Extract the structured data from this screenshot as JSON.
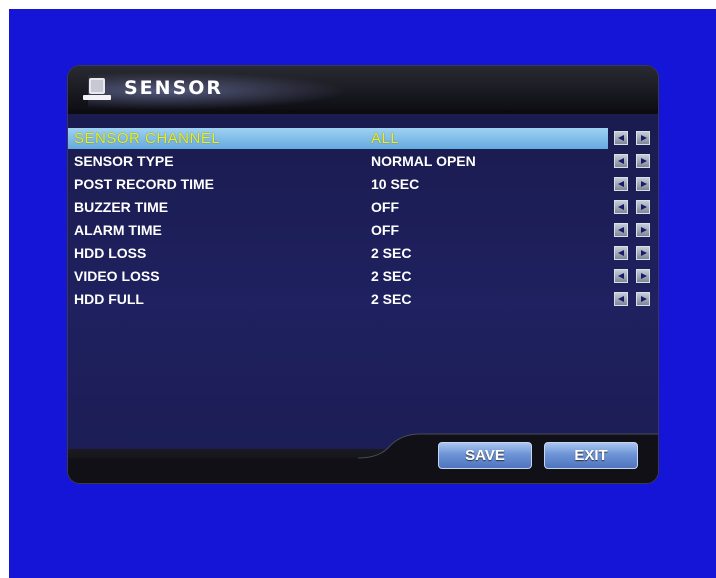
{
  "title": "SENSOR",
  "rows": [
    {
      "label": "SENSOR CHANNEL",
      "value": "ALL"
    },
    {
      "label": "SENSOR TYPE",
      "value": "NORMAL OPEN"
    },
    {
      "label": "POST RECORD TIME",
      "value": "10 SEC"
    },
    {
      "label": "BUZZER TIME",
      "value": "OFF"
    },
    {
      "label": "ALARM TIME",
      "value": "OFF"
    },
    {
      "label": "HDD LOSS",
      "value": "2 SEC"
    },
    {
      "label": "VIDEO LOSS",
      "value": "2 SEC"
    },
    {
      "label": "HDD FULL",
      "value": "2 SEC"
    }
  ],
  "buttons": {
    "save": "SAVE",
    "exit": "EXIT"
  },
  "colors": {
    "background": "#1515d8",
    "selected_row": "#8ac4ee",
    "selected_text": "#e8f21a",
    "button": "#6e94d6"
  },
  "icons": {
    "title": "desk-sensor-icon",
    "decrease": "left-arrow-icon",
    "increase": "right-arrow-icon"
  }
}
